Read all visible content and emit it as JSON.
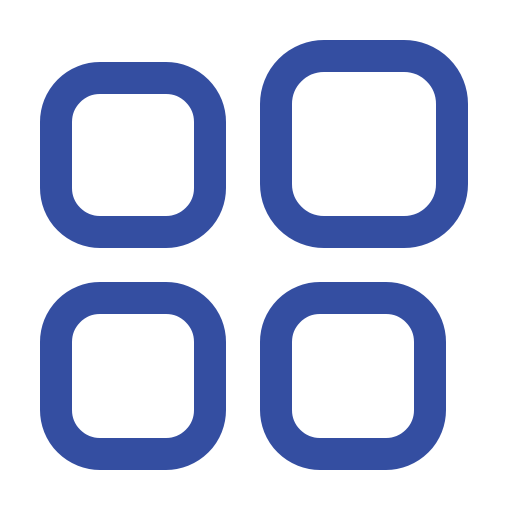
{
  "icon": {
    "name": "app-grid-icon",
    "color": "#344ea1",
    "background": "#ffffff",
    "tiles": [
      {
        "name": "tile-top-left"
      },
      {
        "name": "tile-top-right"
      },
      {
        "name": "tile-bottom-left"
      },
      {
        "name": "tile-bottom-right"
      }
    ]
  }
}
